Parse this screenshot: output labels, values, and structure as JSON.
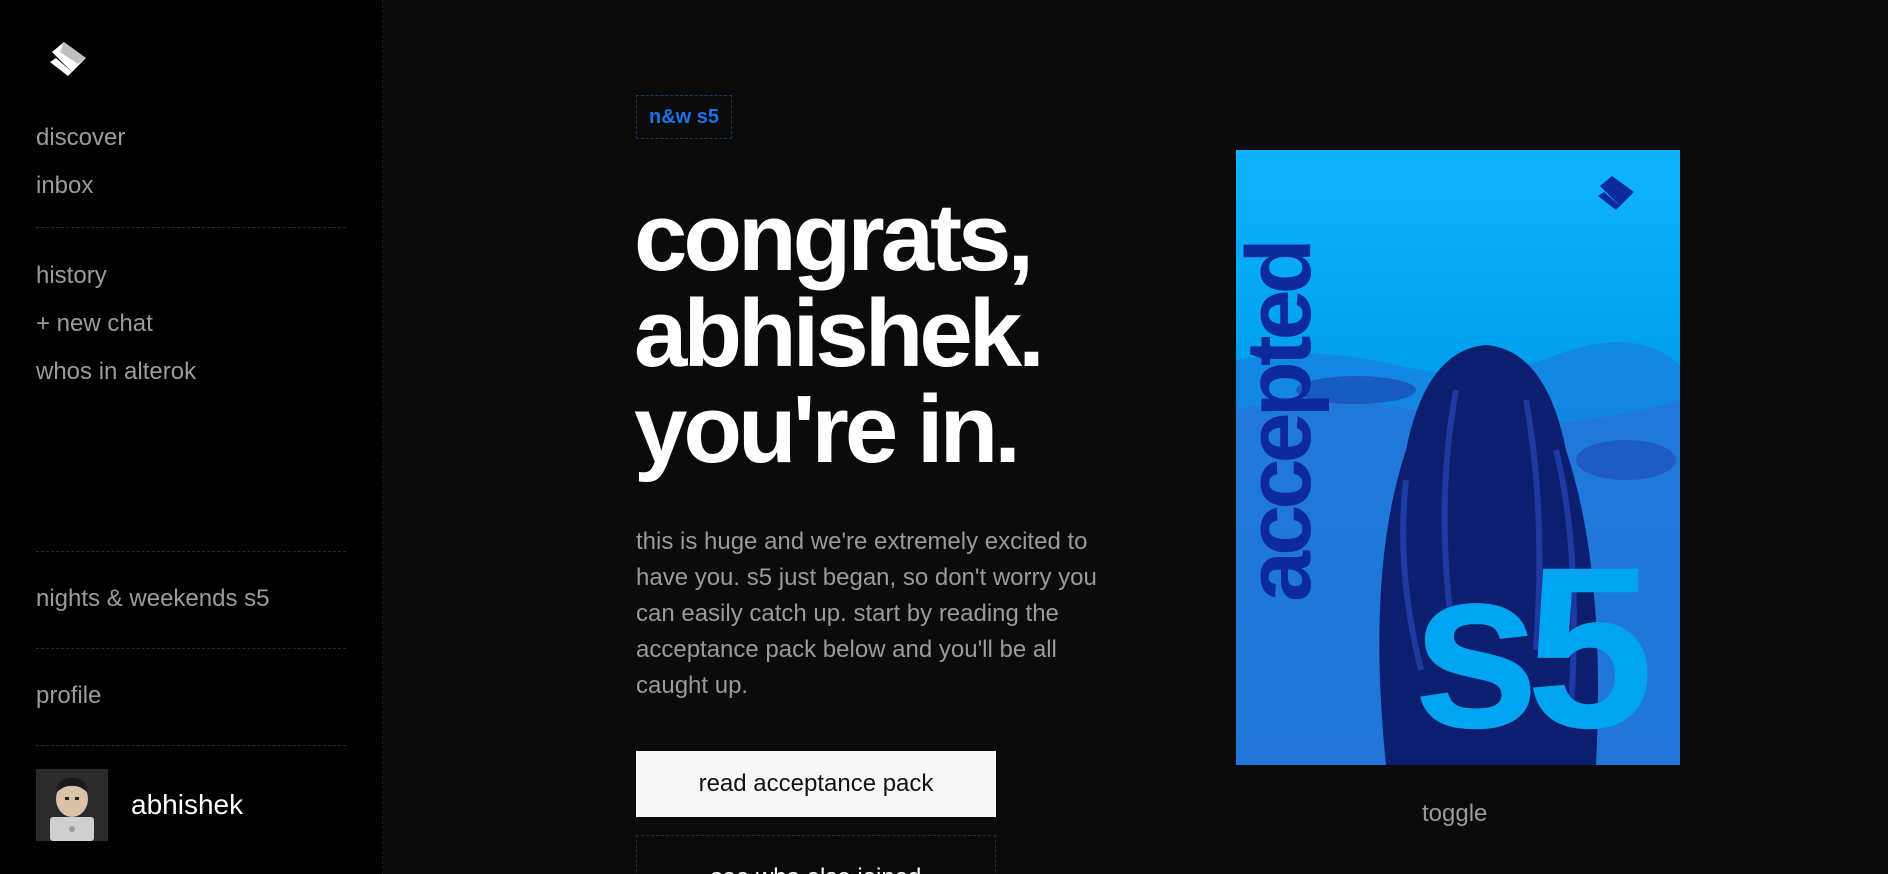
{
  "sidebar": {
    "nav_top": [
      "discover",
      "inbox"
    ],
    "nav_mid": [
      "history",
      "+ new chat",
      "whos in alterok"
    ],
    "program_link": "nights & weekends s5",
    "profile_link": "profile",
    "user": {
      "name": "abhishek"
    }
  },
  "main": {
    "badge": "n&w s5",
    "headline": [
      "congrats,",
      "abhishek.",
      "you're in."
    ],
    "body": "this is huge and we're extremely excited to have you. s5 just began, so don't worry you can easily catch up. start by reading the acceptance pack below and you'll be all caught up.",
    "primary_button": "read acceptance pack",
    "secondary_button": "see who else joined"
  },
  "poster": {
    "vertical_text": "accepted",
    "big_text": "s5",
    "toggle_label": "toggle"
  },
  "colors": {
    "accent_blue": "#1a73e8",
    "poster_bg": "#00a5f2",
    "poster_dark": "#0d2a9c"
  },
  "icons": [
    "logo-icon"
  ]
}
